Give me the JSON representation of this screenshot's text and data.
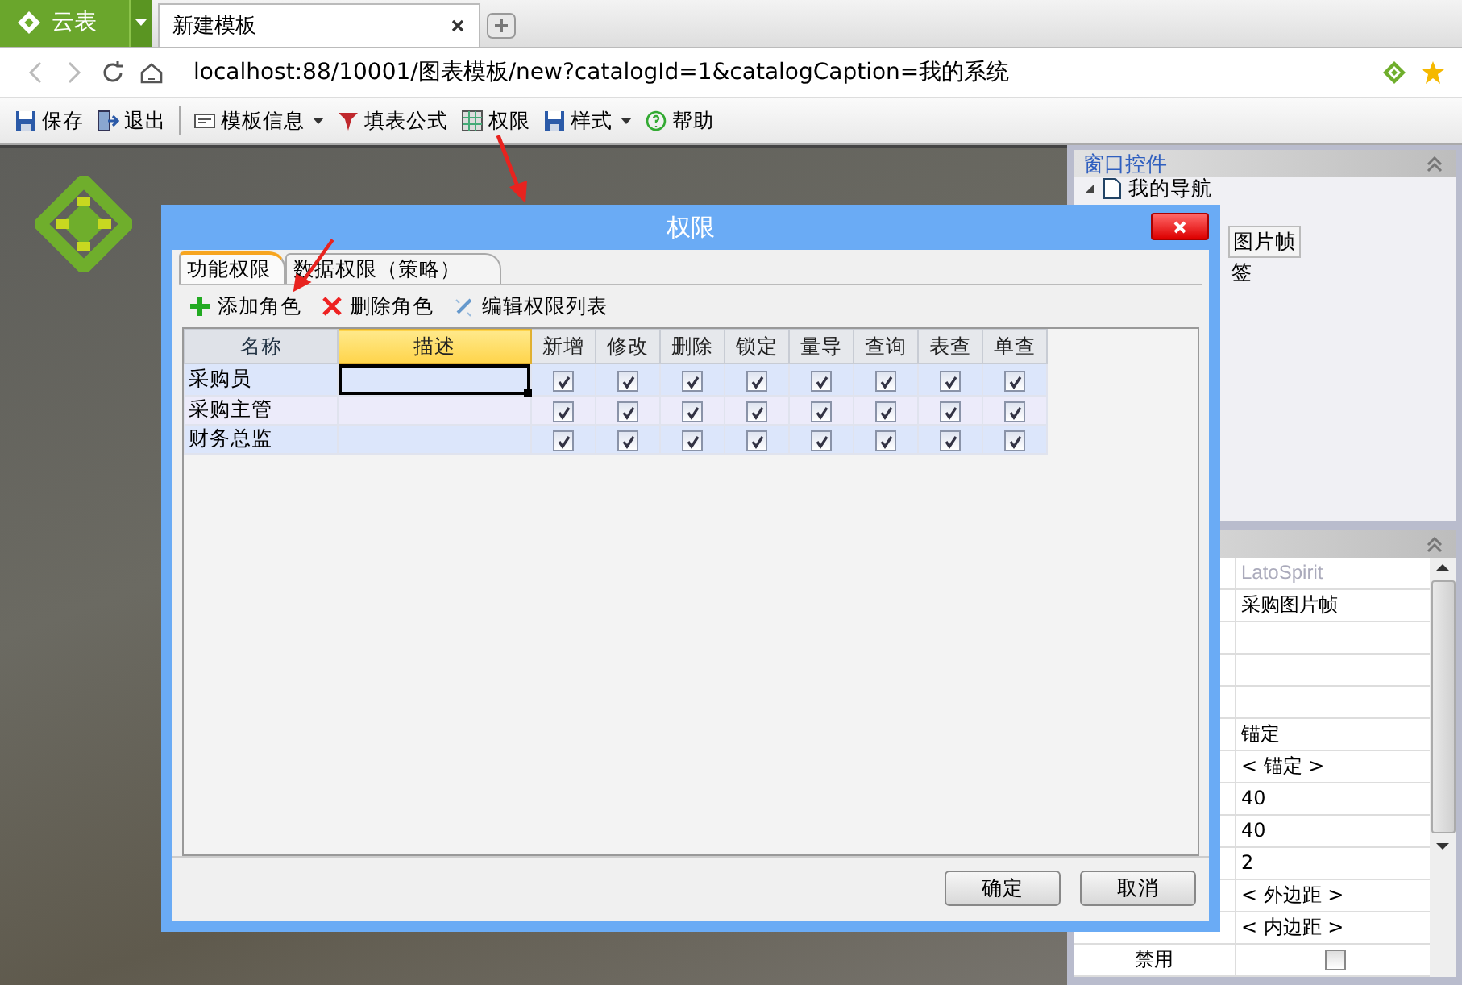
{
  "browser": {
    "app_button": "云表",
    "tabs": [
      {
        "label": "新建模板",
        "selected": true
      }
    ],
    "url": "localhost:88/10001/图表模板/new?catalogId=1&catalogCaption=我的系统"
  },
  "toolbar": [
    {
      "label": "保存",
      "kind": "save",
      "dropdown": false
    },
    {
      "label": "退出",
      "kind": "exit",
      "dropdown": false
    },
    {
      "label": "模板信息",
      "kind": "info",
      "dropdown": true
    },
    {
      "label": "填表公式",
      "kind": "formula",
      "dropdown": false
    },
    {
      "label": "权限",
      "kind": "grid",
      "dropdown": false
    },
    {
      "label": "样式",
      "kind": "save",
      "dropdown": true
    },
    {
      "label": "帮助",
      "kind": "help",
      "dropdown": false
    }
  ],
  "side_panel": {
    "title": "窗口控件",
    "tree": [
      {
        "label": "我的导航",
        "expanded": true,
        "children": [
          {
            "label": "图片帧",
            "selected": true
          },
          {
            "label": "签",
            "selected": false
          }
        ]
      }
    ]
  },
  "properties": {
    "rows": [
      {
        "value": "LatoSpirit",
        "kind": "hint"
      },
      {
        "value": "采购图片帧",
        "kind": "text"
      },
      {
        "value": "",
        "kind": "text"
      },
      {
        "value": "",
        "kind": "text"
      },
      {
        "value": "",
        "kind": "text"
      },
      {
        "value": "锚定",
        "kind": "text"
      },
      {
        "value": "< 锚定 >",
        "kind": "text"
      },
      {
        "value": "40",
        "kind": "text"
      },
      {
        "value": "40",
        "kind": "text"
      },
      {
        "value": "2",
        "kind": "text"
      },
      {
        "value": "< 外边距 >",
        "kind": "text"
      },
      {
        "value": "< 内边距 >",
        "kind": "text"
      },
      {
        "name": "禁用",
        "kind": "checkbox",
        "checked": false
      }
    ]
  },
  "dialog": {
    "title": "权限",
    "tabs": [
      {
        "label": "功能权限",
        "selected": true
      },
      {
        "label": "数据权限（策略）",
        "selected": false
      }
    ],
    "actions": [
      {
        "label": "添加角色",
        "kind": "add"
      },
      {
        "label": "删除角色",
        "kind": "delete"
      },
      {
        "label": "编辑权限列表",
        "kind": "edit"
      }
    ],
    "columns": [
      {
        "label": "名称",
        "kind": "name",
        "selected": false
      },
      {
        "label": "描述",
        "kind": "desc",
        "selected": true
      },
      {
        "label": "新增",
        "kind": "check",
        "selected": false
      },
      {
        "label": "修改",
        "kind": "check",
        "selected": false
      },
      {
        "label": "删除",
        "kind": "check",
        "selected": false
      },
      {
        "label": "锁定",
        "kind": "check",
        "selected": false
      },
      {
        "label": "量导",
        "kind": "check",
        "selected": false
      },
      {
        "label": "查询",
        "kind": "check",
        "selected": false
      },
      {
        "label": "表查",
        "kind": "check",
        "selected": false
      },
      {
        "label": "单查",
        "kind": "check",
        "selected": false
      }
    ],
    "rows": [
      {
        "name": "采购员",
        "active": true,
        "checks": [
          true,
          true,
          true,
          true,
          true,
          true,
          true,
          true
        ]
      },
      {
        "name": "采购主管",
        "active": false,
        "checks": [
          true,
          true,
          true,
          true,
          true,
          true,
          true,
          true
        ]
      },
      {
        "name": "财务总监",
        "active": false,
        "checks": [
          true,
          true,
          true,
          true,
          true,
          true,
          true,
          true
        ]
      }
    ],
    "buttons": [
      "确定",
      "取消"
    ]
  }
}
